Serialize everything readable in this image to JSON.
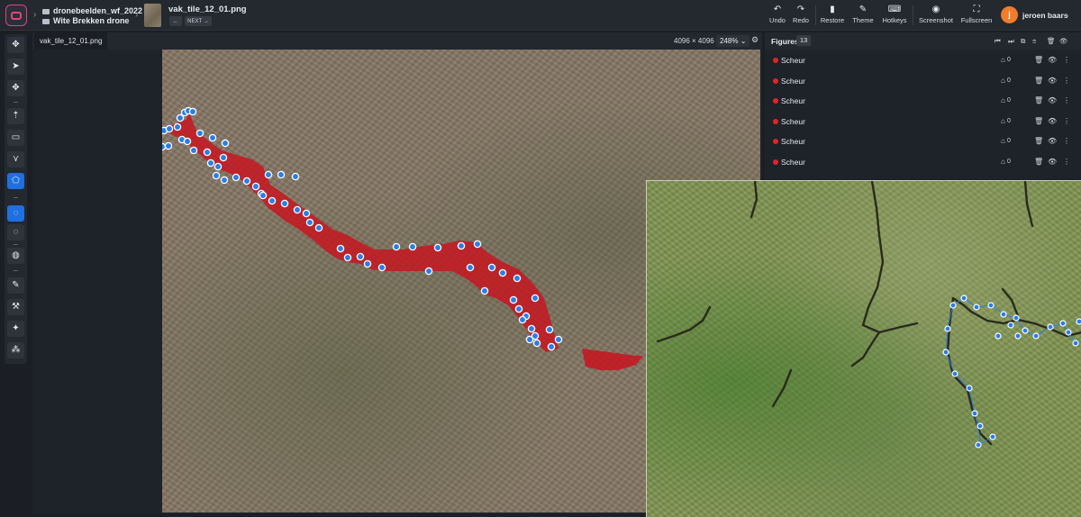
{
  "header": {
    "project": "dronebeelden_wf_2022",
    "dataset": "Wite Brekken drone",
    "file_title": "vak_tile_12_01.png",
    "prev_symbol": "←",
    "next_label": "NEXT",
    "next_symbol": "→",
    "tools": [
      {
        "label": "Undo",
        "icon": "↶"
      },
      {
        "label": "Redo",
        "icon": "↷"
      },
      {
        "label": "Restore",
        "icon": "▮"
      },
      {
        "label": "Theme",
        "icon": "✎"
      },
      {
        "label": "Hotkeys",
        "icon": "⌨"
      },
      {
        "label": "Screenshot",
        "icon": "◉"
      },
      {
        "label": "Fullscreen",
        "icon": "⛶"
      }
    ],
    "user": {
      "initial": "j",
      "name": "jeroen baars",
      "chevron": "⌄"
    }
  },
  "left_toolbar": {
    "tools": [
      "✥",
      "➤",
      "✥",
      "⇡",
      "▭",
      "⋎",
      "⬠",
      "◌",
      "◌",
      "◍",
      "✎",
      "⚒",
      "✦",
      "⁂"
    ]
  },
  "canvas": {
    "tab_label": "vak_tile_12_01.png",
    "dimensions": "4096 × 4096",
    "zoom": "248%",
    "zoom_chevron": "⌄",
    "settings_icon": "⚙"
  },
  "figures_panel": {
    "title": "Figures",
    "count": "13",
    "header_icons": [
      "⏮",
      "⏭",
      "⧉",
      "⩧",
      "🗑",
      "👁"
    ],
    "items": [
      {
        "name": "Scheur",
        "tag_count": "0",
        "color": "#e02525"
      },
      {
        "name": "Scheur",
        "tag_count": "0",
        "color": "#e02525"
      },
      {
        "name": "Scheur",
        "tag_count": "0",
        "color": "#e02525"
      },
      {
        "name": "Scheur",
        "tag_count": "0",
        "color": "#e02525"
      },
      {
        "name": "Scheur",
        "tag_count": "0",
        "color": "#e02525"
      },
      {
        "name": "Scheur",
        "tag_count": "0",
        "color": "#e02525"
      }
    ],
    "item_icons": {
      "tag": "⌂",
      "delete": "🗑",
      "visibility": "👁",
      "more": "⋮"
    }
  },
  "colors": {
    "accent": "#1f6fe0",
    "annotation_fill": "#c8141e",
    "vertex": "#2b7de9",
    "user_avatar": "#ef7d2a"
  }
}
